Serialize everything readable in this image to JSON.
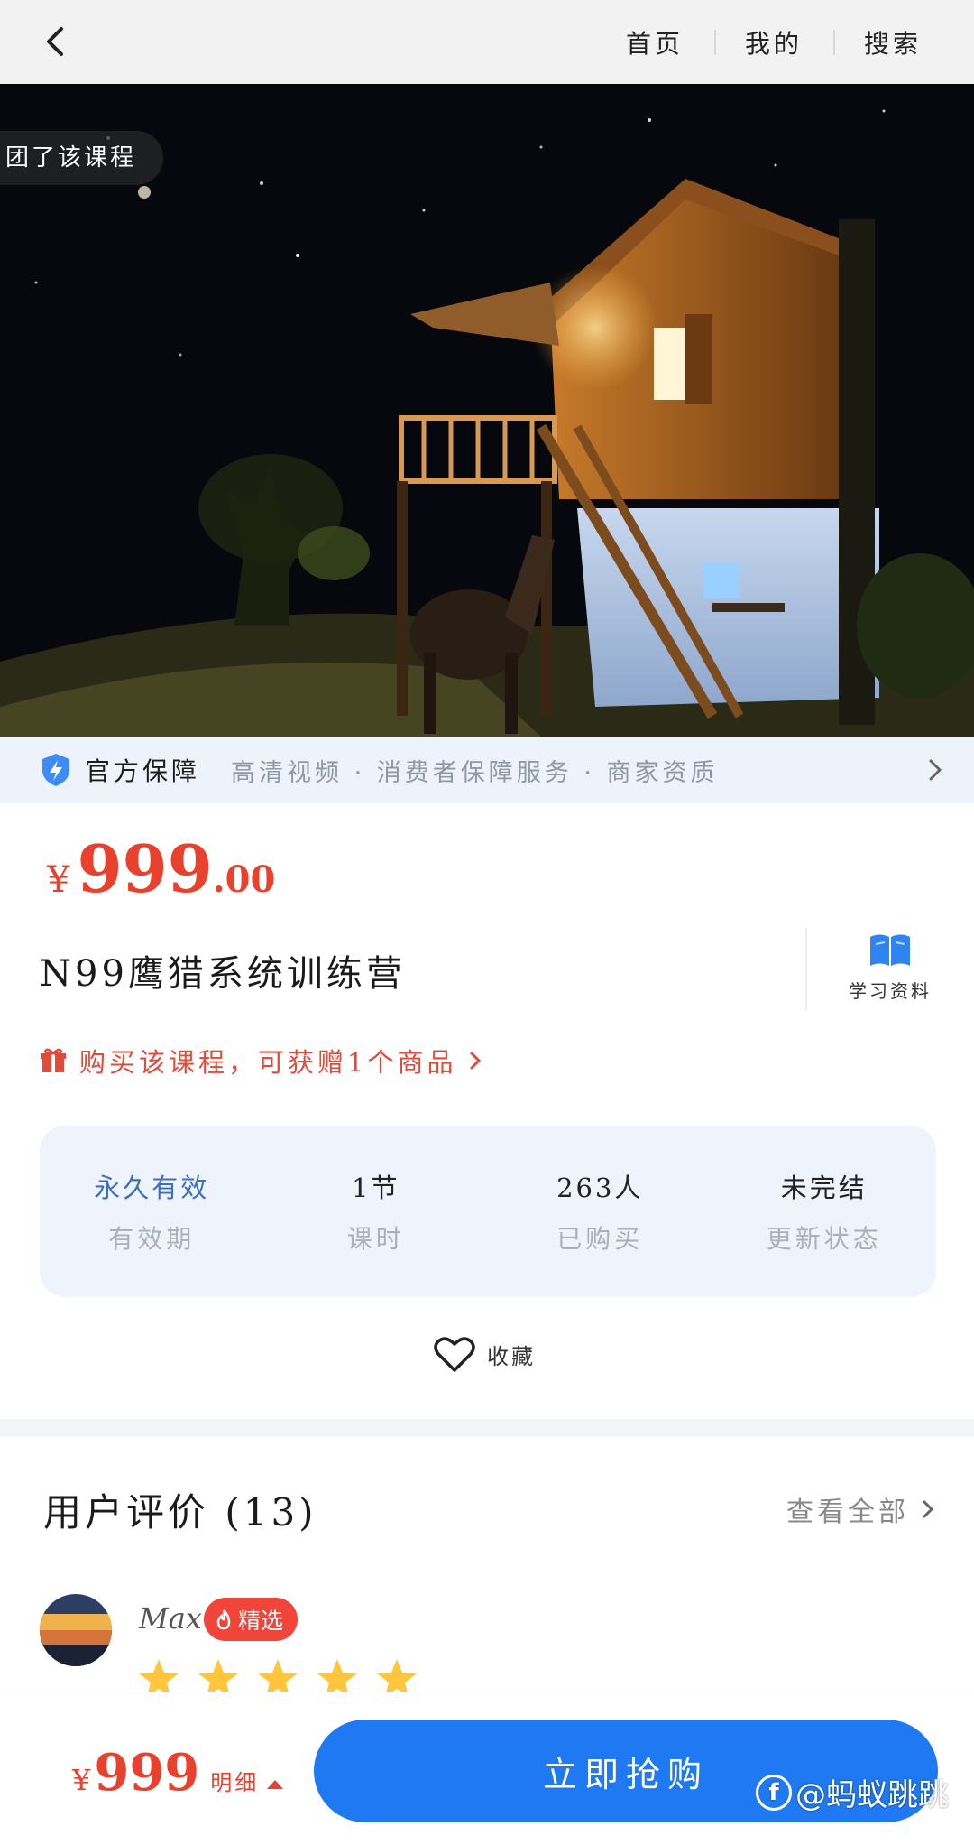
{
  "nav": {
    "links": [
      "首页",
      "我的",
      "搜索"
    ]
  },
  "hero": {
    "pill_text": "团了该课程"
  },
  "guarantee": {
    "title": "官方保障",
    "items": "高清视频 · 消费者保障服务 · 商家资质"
  },
  "product": {
    "price_symbol": "¥",
    "price_int": "999",
    "price_dec": ".00",
    "title": "N99鹰猎系统训练营",
    "study_label": "学习资料",
    "gift_text": "购买该课程，可获赠1个商品"
  },
  "stats": [
    {
      "value": "永久有效",
      "label": "有效期"
    },
    {
      "value": "1节",
      "label": "课时"
    },
    {
      "value": "263人",
      "label": "已购买"
    },
    {
      "value": "未完结",
      "label": "更新状态"
    }
  ],
  "favorite": {
    "label": "收藏"
  },
  "reviews": {
    "title": "用户评价 (13)",
    "view_all": "查看全部",
    "first": {
      "name": "Max",
      "badge": "精选",
      "rating": 5
    }
  },
  "bottom": {
    "price_symbol": "¥",
    "price": "999",
    "detail": "明细",
    "buy_label": "立即抢购",
    "watermark": "@蚂蚁跳跳"
  },
  "colors": {
    "accent_red": "#e8422f",
    "buy_blue": "#1f79f3",
    "stats_bg": "#eff4fc",
    "guarantee_bg": "#eef3fb"
  }
}
